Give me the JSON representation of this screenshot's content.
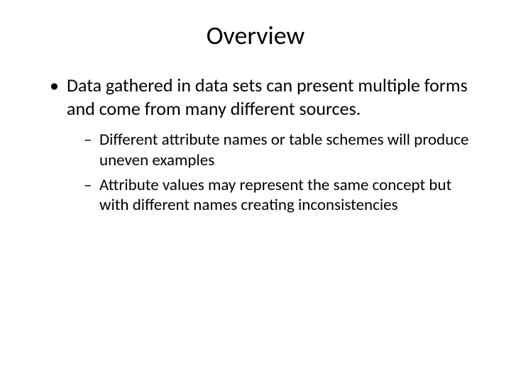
{
  "title": "Overview",
  "bullets": {
    "main": "Data gathered in data sets can present multiple forms and come from many different sources.",
    "sub1": "Different attribute names or table schemes will produce uneven examples",
    "sub2": "Attribute values may represent the same concept but with different names creating inconsistencies"
  }
}
